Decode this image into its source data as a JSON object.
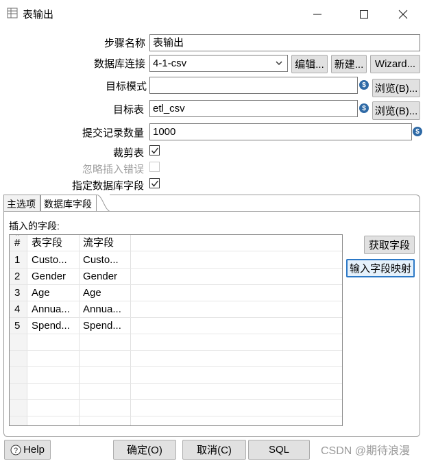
{
  "window": {
    "title": "表输出",
    "minimize_icon": "minimize-icon",
    "maximize_icon": "maximize-icon",
    "close_icon": "close-icon"
  },
  "form": {
    "step_name": {
      "label": "步骤名称",
      "value": "表输出"
    },
    "db_connection": {
      "label": "数据库连接",
      "value": "4-1-csv",
      "edit_button": "编辑...",
      "new_button": "新建...",
      "wizard_button": "Wizard..."
    },
    "target_schema": {
      "label": "目标模式",
      "value": "",
      "browse_button": "浏览(B)..."
    },
    "target_table": {
      "label": "目标表",
      "value": "etl_csv",
      "browse_button": "浏览(B)..."
    },
    "commit_size": {
      "label": "提交记录数量",
      "value": "1000"
    },
    "truncate_table": {
      "label": "裁剪表",
      "checked": true
    },
    "ignore_insert_errors": {
      "label": "忽略插入错误",
      "checked": false,
      "disabled": true
    },
    "specify_db_fields": {
      "label": "指定数据库字段",
      "checked": true
    }
  },
  "tabs": [
    {
      "label": "主选项",
      "active": false
    },
    {
      "label": "数据库字段",
      "active": true
    }
  ],
  "fields_panel": {
    "heading": "插入的字段:",
    "columns": [
      "#",
      "表字段",
      "流字段"
    ],
    "rows": [
      {
        "num": "1",
        "table_field": "Custo...",
        "stream_field": "Custo..."
      },
      {
        "num": "2",
        "table_field": "Gender",
        "stream_field": "Gender"
      },
      {
        "num": "3",
        "table_field": "Age",
        "stream_field": "Age"
      },
      {
        "num": "4",
        "table_field": "Annua...",
        "stream_field": "Annua..."
      },
      {
        "num": "5",
        "table_field": "Spend...",
        "stream_field": "Spend..."
      }
    ],
    "get_fields_button": "获取字段",
    "map_fields_button": "输入字段映射"
  },
  "footer": {
    "help_button": "Help",
    "ok_button": "确定(O)",
    "cancel_button": "取消(C)",
    "sql_button": "SQL",
    "watermark": "CSDN @期待浪漫"
  },
  "colors": {
    "variable_icon": "#2f6aa6",
    "focus_border": "#2b78c6"
  }
}
